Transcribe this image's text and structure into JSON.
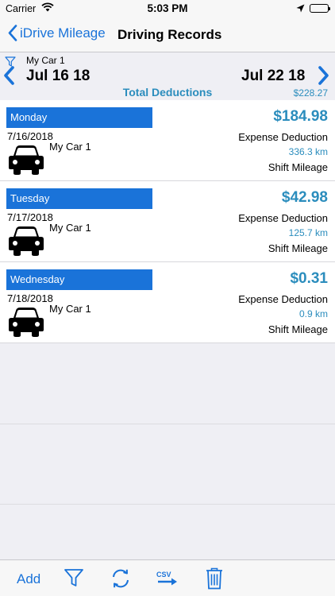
{
  "status": {
    "carrier": "Carrier",
    "time": "5:03 PM"
  },
  "nav": {
    "back_label": "iDrive Mileage",
    "title": "Driving Records"
  },
  "header": {
    "car": "My Car 1",
    "start_date": "Jul 16 18",
    "end_date": "Jul 22 18",
    "total_label": "Total Deductions",
    "total_value": "$228.27"
  },
  "records": [
    {
      "day": "Monday",
      "date": "7/16/2018",
      "car": "My Car 1",
      "amount": "$184.98",
      "expense_label": "Expense Deduction",
      "distance": "336.3 km",
      "mileage_label": "Shift Mileage"
    },
    {
      "day": "Tuesday",
      "date": "7/17/2018",
      "car": "My Car 1",
      "amount": "$42.98",
      "expense_label": "Expense Deduction",
      "distance": "125.7 km",
      "mileage_label": "Shift Mileage"
    },
    {
      "day": "Wednesday",
      "date": "7/18/2018",
      "car": "My Car 1",
      "amount": "$0.31",
      "expense_label": "Expense Deduction",
      "distance": "0.9 km",
      "mileage_label": "Shift Mileage"
    }
  ],
  "toolbar": {
    "add_label": "Add",
    "csv_label": "CSV"
  },
  "colors": {
    "accent": "#1a73d9",
    "value": "#2b8dbd"
  }
}
